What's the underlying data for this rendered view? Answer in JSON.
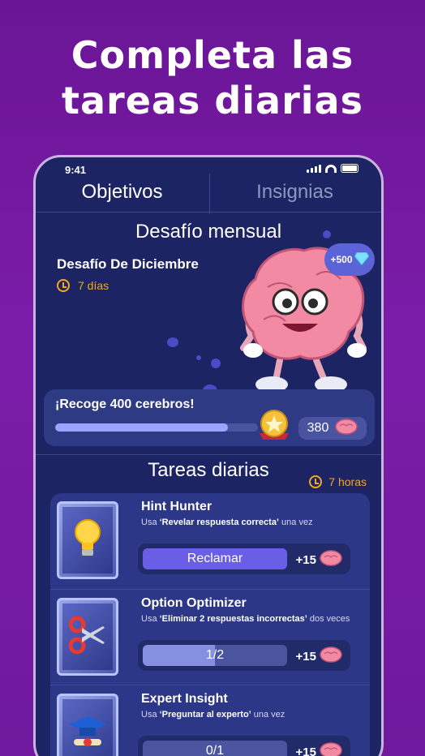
{
  "headline": {
    "line1": "Completa las",
    "line2": "tareas diarias"
  },
  "status_bar": {
    "time": "9:41"
  },
  "tabs": [
    {
      "label": "Objetivos",
      "active": true
    },
    {
      "label": "Insignias",
      "active": false
    }
  ],
  "monthly": {
    "title": "Desafío mensual",
    "challenge_name": "Desafío De Diciembre",
    "duration": "7 días",
    "bonus": "+500",
    "collect_label": "¡Recoge 400 cerebros!",
    "count": "380",
    "progress_fraction": 0.95
  },
  "daily": {
    "title": "Tareas diarias",
    "time_left": "7 horas",
    "tasks": [
      {
        "name": "Hint Hunter",
        "desc_prefix": "Usa ",
        "desc_bold": "‘Revelar respuesta correcta’",
        "desc_suffix": " una vez",
        "action": "Reclamar",
        "reward": "+15",
        "icon": "lightbulb-icon"
      },
      {
        "name": "Option Optimizer",
        "desc_prefix": "Usa ",
        "desc_bold": "‘Eliminar 2 respuestas incorrectas’",
        "desc_suffix": " dos veces",
        "action": "1/2",
        "progress_fraction": 0.5,
        "reward": "+15",
        "icon": "scissors-icon"
      },
      {
        "name": "Expert Insight",
        "desc_prefix": "Usa ",
        "desc_bold": "‘Preguntar al experto’",
        "desc_suffix": " una vez",
        "action": "0/1",
        "progress_fraction": 0,
        "reward": "+15",
        "icon": "graduation-cap-icon"
      }
    ]
  },
  "colors": {
    "accent_orange": "#f5a623",
    "claim_purple": "#6a5ee6",
    "panel_blue": "#1c2464"
  }
}
